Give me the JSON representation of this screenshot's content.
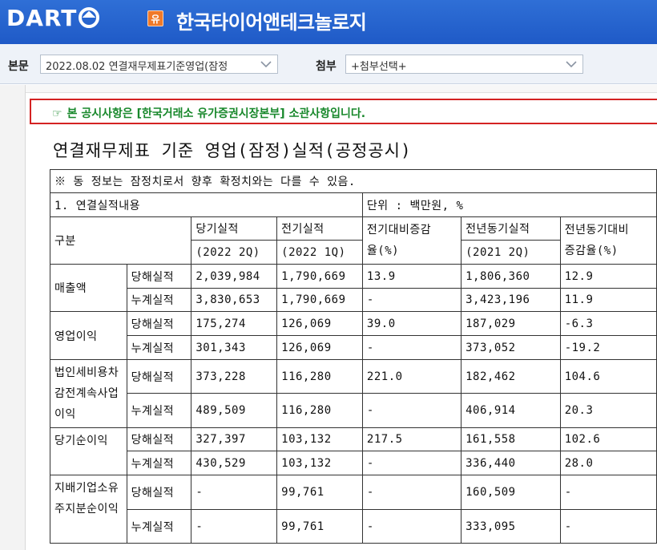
{
  "header": {
    "logo_text": "DART",
    "company_badge": "유",
    "company_name": "한국타이어앤테크놀로지"
  },
  "selectors": {
    "main_label": "본문",
    "main_value": "2022.08.02  연결재무제표기준영업(잠정",
    "attach_label": "첨부",
    "attach_value": "+첨부선택+"
  },
  "notice": {
    "icon": "hand-pointing-icon",
    "text": "본 공시사항은 [한국거래소 유가증권시장본부] 소관사항입니다."
  },
  "doc": {
    "title": "연결재무제표 기준 영업(잠정)실적(공정공시)"
  },
  "table": {
    "note": "※ 동 정보는 잠정치로서 향후 확정치와는 다를 수 있음.",
    "section": "1. 연결실적내용",
    "unit": "단위 : 백만원, %",
    "col_category": "구분",
    "col_current": "당기실적",
    "col_current_period": "(2022 2Q)",
    "col_previous": "전기실적",
    "col_previous_period": "(2022 1Q)",
    "col_qoq_line1": "전기대비증감",
    "col_qoq_line2": "율(%)",
    "col_yoy": "전년동기실적",
    "col_yoy_period": "(2021 2Q)",
    "col_yoy_rate_line1": "전년동기대비",
    "col_yoy_rate_line2": "증감율(%)",
    "rows": [
      {
        "item": "매출액",
        "quarter": {
          "label": "당해실적",
          "current": "2,039,984",
          "previous": "1,790,669",
          "qoq": "13.9",
          "yoy": "1,806,360",
          "yoy_rate": "12.9"
        },
        "cumulative": {
          "label": "누계실적",
          "current": "3,830,653",
          "previous": "1,790,669",
          "qoq": "-",
          "yoy": "3,423,196",
          "yoy_rate": "11.9"
        }
      },
      {
        "item": "영업이익",
        "quarter": {
          "label": "당해실적",
          "current": "175,274",
          "previous": "126,069",
          "qoq": "39.0",
          "yoy": "187,029",
          "yoy_rate": "-6.3"
        },
        "cumulative": {
          "label": "누계실적",
          "current": "301,343",
          "previous": "126,069",
          "qoq": "-",
          "yoy": "373,052",
          "yoy_rate": "-19.2"
        }
      },
      {
        "item": "법인세비용차감전계속사업이익",
        "quarter": {
          "label": "당해실적",
          "current": "373,228",
          "previous": "116,280",
          "qoq": "221.0",
          "yoy": "182,462",
          "yoy_rate": "104.6"
        },
        "cumulative": {
          "label": "누계실적",
          "current": "489,509",
          "previous": "116,280",
          "qoq": "-",
          "yoy": "406,914",
          "yoy_rate": "20.3"
        }
      },
      {
        "item": "당기순이익",
        "quarter": {
          "label": "당해실적",
          "current": "327,397",
          "previous": "103,132",
          "qoq": "217.5",
          "yoy": "161,558",
          "yoy_rate": "102.6"
        },
        "cumulative": {
          "label": "누계실적",
          "current": "430,529",
          "previous": "103,132",
          "qoq": "-",
          "yoy": "336,440",
          "yoy_rate": "28.0"
        }
      },
      {
        "item": "지배기업소유주지분순이익",
        "quarter": {
          "label": "당해실적",
          "current": "-",
          "previous": "99,761",
          "qoq": "-",
          "yoy": "160,509",
          "yoy_rate": "-"
        },
        "cumulative": {
          "label": "누계실적",
          "current": "-",
          "previous": "99,761",
          "qoq": "-",
          "yoy": "333,095",
          "yoy_rate": "-"
        }
      }
    ]
  }
}
